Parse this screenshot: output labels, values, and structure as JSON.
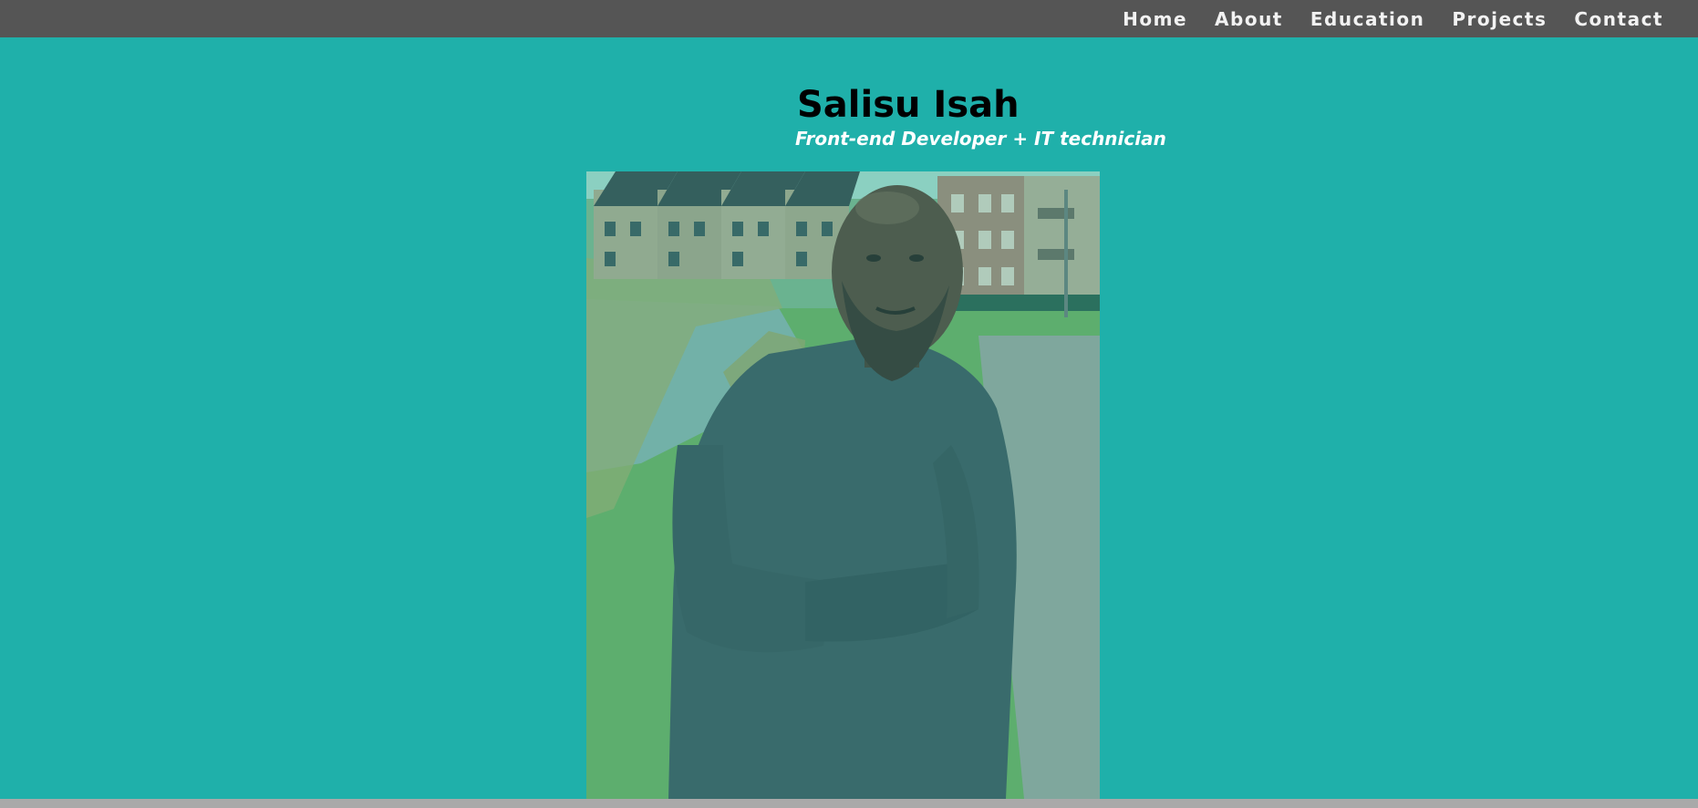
{
  "colors": {
    "page_background": "#1fb0aa",
    "navbar_background": "#555555",
    "nav_text": "#f2f2f2",
    "name_text": "#000000",
    "tagline_text": "#ffffff",
    "footer_strip": "#a9a9a9"
  },
  "nav": {
    "items": [
      {
        "label": "Home"
      },
      {
        "label": "About"
      },
      {
        "label": "Education"
      },
      {
        "label": "Projects"
      },
      {
        "label": "Contact"
      }
    ]
  },
  "hero": {
    "name": "Salisu Isah",
    "tagline": "Front-end Developer + IT technician",
    "photo": {
      "icon": "profile-photo"
    }
  }
}
